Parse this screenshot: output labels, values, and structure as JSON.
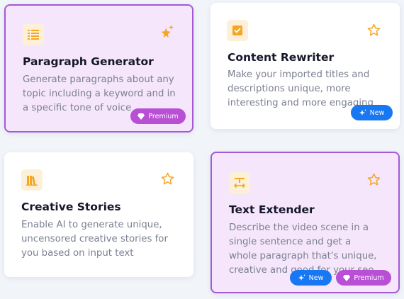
{
  "cards": [
    {
      "title": "Paragraph Generator",
      "description": "Generate paragraphs about any topic including a keyword and in a specific tone of voice",
      "icon": "paragraph-lines-icon",
      "favorite_icon": "sparkle-star-icon",
      "selected": true,
      "badges": [
        "Premium"
      ]
    },
    {
      "title": "Content Rewriter",
      "description": "Make your imported titles and descriptions unique, more interesting and more engaging",
      "icon": "checkbox-icon",
      "favorite_icon": "star-outline-icon",
      "selected": false,
      "badges": [
        "New"
      ]
    },
    {
      "title": "Creative Stories",
      "description": "Enable AI to generate unique, uncensored creative stories for you based on input text",
      "icon": "books-icon",
      "favorite_icon": "star-outline-icon",
      "selected": false,
      "badges": []
    },
    {
      "title": "Text Extender",
      "description": "Describe the video scene in a single sentence and get a whole paragraph that's unique, creative and good for your seo",
      "icon": "text-expand-icon",
      "favorite_icon": "star-outline-icon",
      "selected": true,
      "badges": [
        "New",
        "Premium"
      ]
    }
  ],
  "colors": {
    "accent_purple": "#a25ad6",
    "premium_badge": "#b84fd4",
    "new_badge": "#1877f2",
    "icon_orange": "#f5a623",
    "background": "#f1f4f9"
  }
}
